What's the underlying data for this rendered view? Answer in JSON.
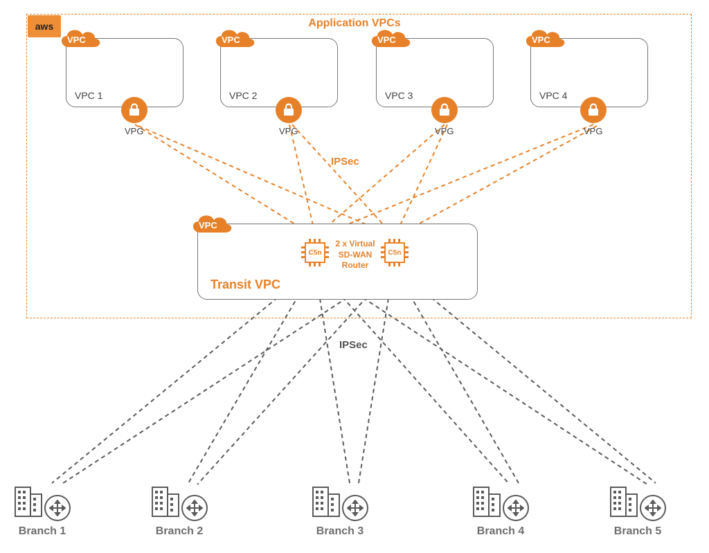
{
  "logo": "aws",
  "sectionTitle": "Application VPCs",
  "cloudLabel": "VPC",
  "vpcs": [
    {
      "name": "VPC 1"
    },
    {
      "name": "VPC 2"
    },
    {
      "name": "VPC 3"
    },
    {
      "name": "VPC 4"
    }
  ],
  "vpgLabel": "VPG",
  "ipsecTop": "IPSec",
  "ipsecBottom": "IPSec",
  "transit": {
    "label": "Transit VPC",
    "chip": "C5n",
    "routerLabel": "2 x Virtual\nSD-WAN\nRouter"
  },
  "branches": [
    {
      "label": "Branch 1"
    },
    {
      "label": "Branch 2"
    },
    {
      "label": "Branch 3"
    },
    {
      "label": "Branch 4"
    },
    {
      "label": "Branch 5"
    }
  ]
}
